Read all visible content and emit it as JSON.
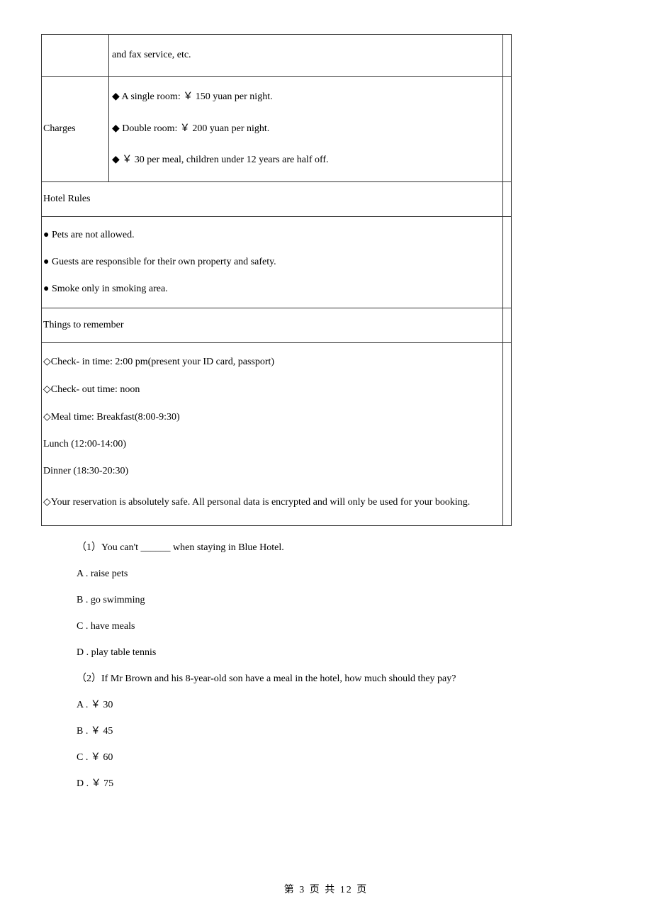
{
  "table": {
    "row1_content": "and fax service, etc.",
    "charges_label": "Charges",
    "charges_lines": [
      "◆ A single room: ￥ 150 yuan per night.",
      "◆ Double room: ￥ 200 yuan per night.",
      "◆ ￥ 30 per meal, children under 12 years are half off."
    ],
    "hotel_rules_header": "Hotel Rules",
    "hotel_rules_lines": [
      "● Pets are not allowed.",
      "● Guests are responsible for their own property and safety.",
      "●  Smoke only in smoking area."
    ],
    "things_header": "Things to remember",
    "things_lines": [
      "◇Check- in time: 2:00 pm(present your ID card, passport)",
      "◇Check- out time: noon",
      "◇Meal time: Breakfast(8:00-9:30)",
      "Lunch     (12:00-14:00)",
      "Dinner    (18:30-20:30)",
      "◇Your reservation is absolutely safe. All personal data is encrypted and will only be used for your booking."
    ]
  },
  "questions": [
    {
      "stem": "（1）You can't ______ when staying in Blue Hotel.",
      "options": [
        "A . raise pets",
        "B . go swimming",
        "C . have meals",
        "D . play table tennis"
      ]
    },
    {
      "stem": "（2）If Mr Brown and his 8-year-old son have a meal in the hotel, how much should they pay?",
      "options": [
        "A . ￥ 30",
        "B . ￥ 45",
        "C . ￥ 60",
        "D . ￥ 75"
      ]
    }
  ],
  "footer": "第 3 页 共 12 页"
}
